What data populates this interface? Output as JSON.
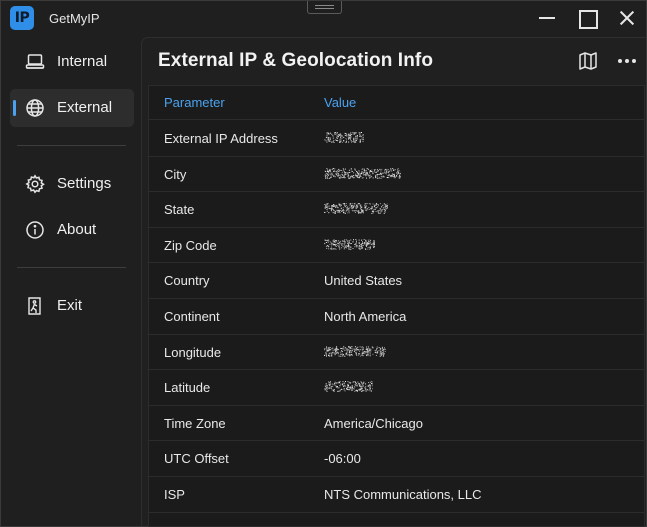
{
  "app": {
    "title": "GetMyIP",
    "icon_text": "IP",
    "accent_color": "#4aa3f0"
  },
  "window_controls": [
    "minimize-icon",
    "maximize-icon",
    "close-icon"
  ],
  "sidebar": {
    "items": [
      {
        "label": "Internal",
        "icon": "laptop-icon",
        "selected": false
      },
      {
        "label": "External",
        "icon": "globe-icon",
        "selected": true
      },
      {
        "label": "Settings",
        "icon": "gear-icon",
        "selected": false
      },
      {
        "label": "About",
        "icon": "info-icon",
        "selected": false
      },
      {
        "label": "Exit",
        "icon": "exit-icon",
        "selected": false
      }
    ]
  },
  "main": {
    "title": "External IP & Geolocation Info",
    "header_actions": [
      "map-icon",
      "more-icon"
    ],
    "table": {
      "columns": [
        "Parameter",
        "Value"
      ],
      "rows": [
        {
          "parameter": "External IP Address",
          "value": "",
          "redacted": true
        },
        {
          "parameter": "City",
          "value": "",
          "redacted": true
        },
        {
          "parameter": "State",
          "value": "",
          "redacted": true
        },
        {
          "parameter": "Zip Code",
          "value": "",
          "redacted": true
        },
        {
          "parameter": "Country",
          "value": "United States",
          "redacted": false
        },
        {
          "parameter": "Continent",
          "value": "North America",
          "redacted": false
        },
        {
          "parameter": "Longitude",
          "value": "",
          "redacted": true
        },
        {
          "parameter": "Latitude",
          "value": "",
          "redacted": true
        },
        {
          "parameter": "Time Zone",
          "value": "America/Chicago",
          "redacted": false
        },
        {
          "parameter": "UTC Offset",
          "value": "-06:00",
          "redacted": false
        },
        {
          "parameter": "ISP",
          "value": "NTS Communications, LLC",
          "redacted": false
        }
      ]
    }
  }
}
